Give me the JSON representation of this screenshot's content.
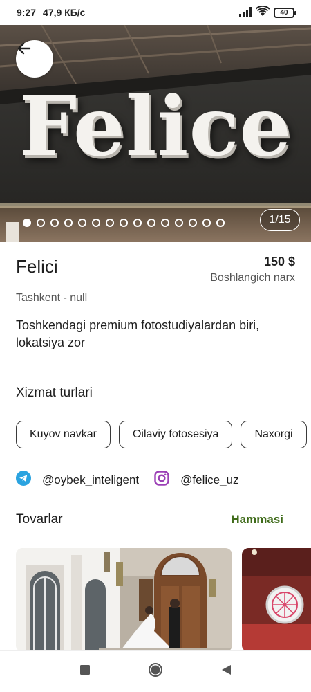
{
  "status": {
    "time": "9:27",
    "speed": "47,9 КБ/с",
    "battery": "40"
  },
  "gallery": {
    "sign": "Felice",
    "counter": "1/15",
    "total": 15,
    "active_index": 0
  },
  "studio": {
    "name": "Felici",
    "price": "150 $",
    "price_note": "Boshlangich narx",
    "location": "Tashkent - null",
    "description": "Toshkendagi premium fotostudiyalardan biri, lokatsiya zor"
  },
  "services": {
    "title": "Xizmat turlari",
    "items": [
      "Kuyov navkar",
      "Oilaviy fotosesiya",
      "Naxorgi"
    ]
  },
  "socials": {
    "telegram": "@oybek_inteligent",
    "instagram": "@felice_uz"
  },
  "products": {
    "title": "Tovarlar",
    "see_all": "Hammasi"
  },
  "colors": {
    "accent_green": "#3f6b1a",
    "telegram": "#2aa3e0",
    "instagram": "#9b3fb6"
  }
}
